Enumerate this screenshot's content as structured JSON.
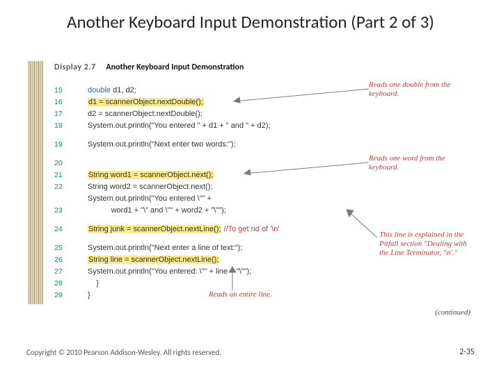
{
  "title": "Another Keyboard Input Demonstration (Part 2 of 3)",
  "display": {
    "label": "Display 2.7",
    "caption": "Another Keyboard Input Demonstration"
  },
  "lines": {
    "l15_num": "15",
    "l15_kw": "double",
    "l15_rest": " d1, d2;",
    "l16_num": "16",
    "l16_hl": "d1 = scannerObject.nextDouble();",
    "l17_num": "17",
    "l17_txt": "d2 = scannerObject.nextDouble();",
    "l18_num": "18",
    "l18_txt": "System.out.println(\"You entered \" + d1 + \" and \" + d2);",
    "l19_num": "19",
    "l19_txt": "System.out.println(\"Next enter two words:\");",
    "l20_num": "20",
    "l21_num": "21",
    "l21_hl": "String word1 = scannerObject.next();",
    "l22_num": "22",
    "l22_txt": "String word2 = scannerObject.next();",
    "l23a": "System.out.println(\"You entered \\\"\" +",
    "l23_num": "23",
    "l23b": "           word1 + \"\\\" and \\\"\" + word2 + \"\\\"\");",
    "l24_num": "24",
    "l24_hl": "String junk = scannerObject.nextLine();",
    "l24_cmt": " //To get rid of '\\n'",
    "l25_num": "25",
    "l25_txt": "System.out.println(\"Next enter a line of text:\");",
    "l26_num": "26",
    "l26_hl": "String line = scannerObject.nextLine();",
    "l27_num": "27",
    "l27_txt": "System.out.println(\"You entered: \\\"\" + line + \"\\\"\");",
    "l28_num": "28",
    "l28_txt": "    }",
    "l29_num": "29",
    "l29_txt": "}"
  },
  "annotations": {
    "a1": "Reads one double from the keyboard.",
    "a2": "Reads one word from the keyboard.",
    "a3": "This line is explained in the Pitfall section \"Dealing with the Line Terminator, '\\n'.\"",
    "a4": "Reads an entire line."
  },
  "continued": "(continued)",
  "footer": {
    "copyright": "Copyright © 2010 Pearson Addison-Wesley. All rights reserved.",
    "page": "2-35"
  }
}
